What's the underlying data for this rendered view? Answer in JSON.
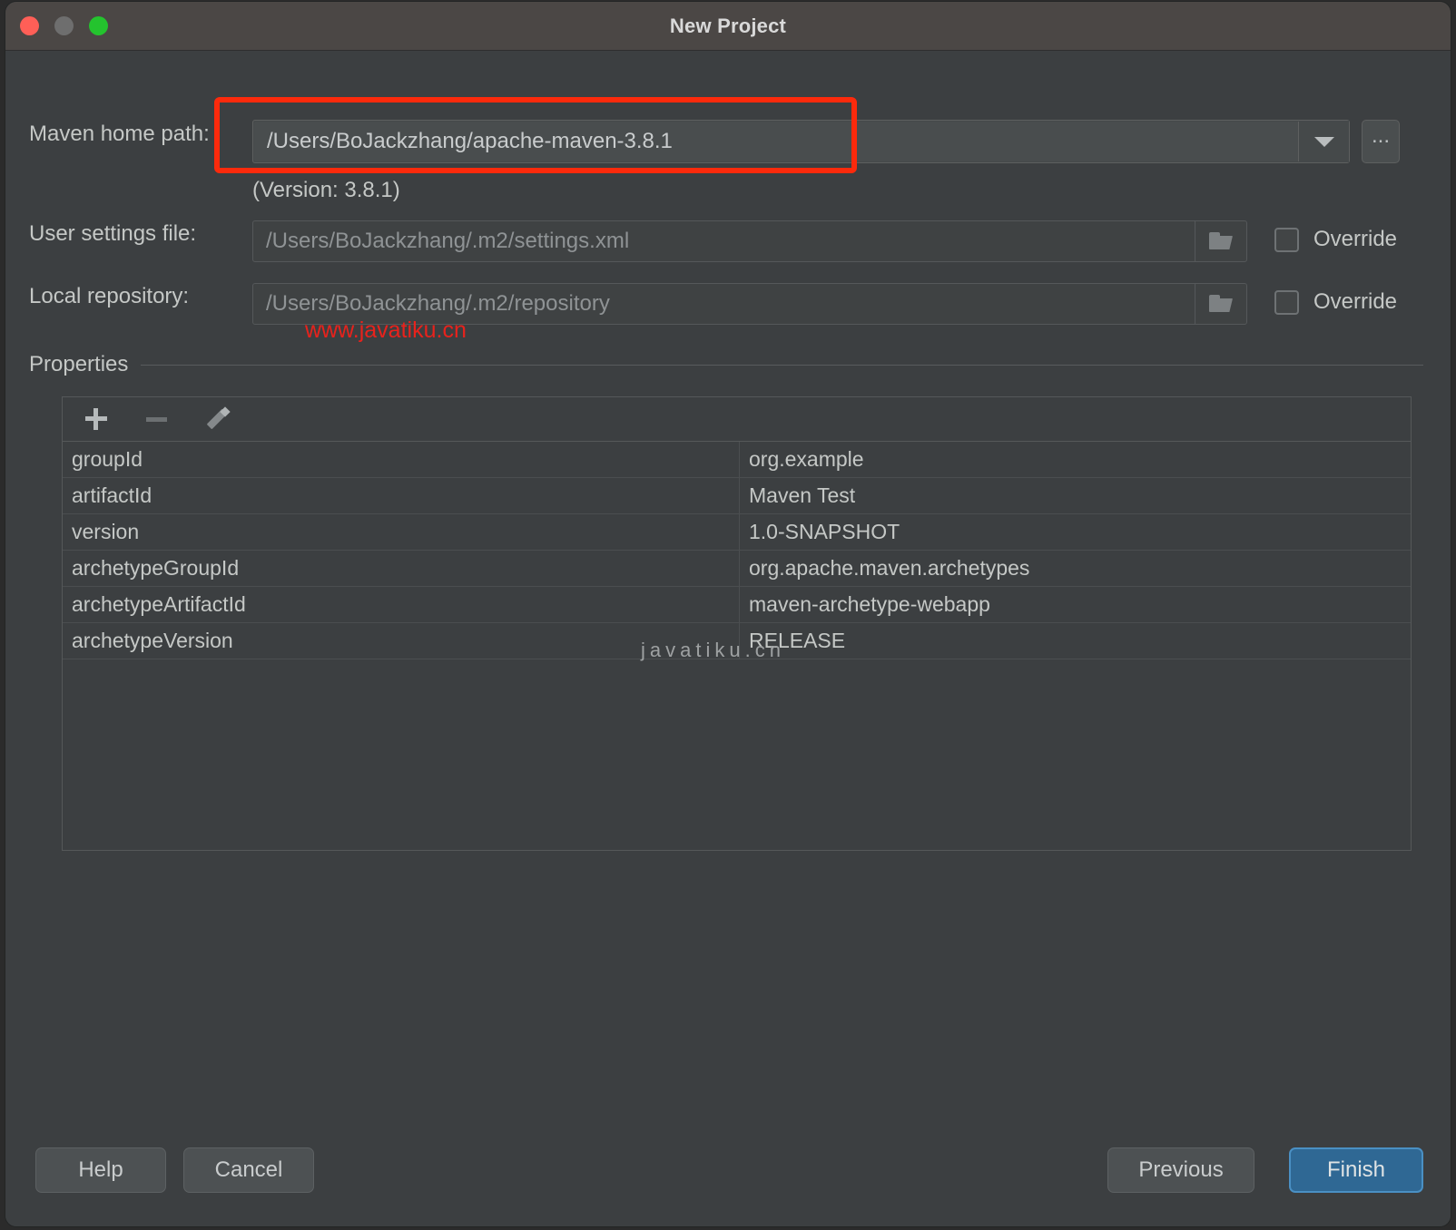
{
  "window": {
    "title": "New Project",
    "traffic_lights": [
      "close-button",
      "minimize-button",
      "zoom-button"
    ]
  },
  "form": {
    "maven_home_label": "Maven home path:",
    "maven_home_value": "/Users/BoJackzhang/apache-maven-3.8.1",
    "version_note": "(Version: 3.8.1)",
    "ellipsis_label": "...",
    "user_settings_label": "User settings file:",
    "user_settings_value": "/Users/BoJackzhang/.m2/settings.xml",
    "user_settings_override_label": "Override",
    "local_repo_label": "Local repository:",
    "local_repo_value": "/Users/BoJackzhang/.m2/repository",
    "local_repo_override_label": "Override"
  },
  "properties": {
    "section_title": "Properties",
    "toolbar": {
      "add_label": "add-property",
      "remove_label": "remove-property",
      "edit_label": "edit-property"
    },
    "rows": [
      {
        "key": "groupId",
        "value": "org.example"
      },
      {
        "key": "artifactId",
        "value": "Maven Test"
      },
      {
        "key": "version",
        "value": "1.0-SNAPSHOT"
      },
      {
        "key": "archetypeGroupId",
        "value": "org.apache.maven.archetypes"
      },
      {
        "key": "archetypeArtifactId",
        "value": "maven-archetype-webapp"
      },
      {
        "key": "archetypeVersion",
        "value": "RELEASE"
      }
    ]
  },
  "watermarks": {
    "red": "www.javatiku.cn",
    "gray": "javatiku.cn"
  },
  "footer": {
    "help": "Help",
    "cancel": "Cancel",
    "previous": "Previous",
    "finish": "Finish"
  },
  "colors": {
    "dialog_bg": "#3c3f41",
    "titlebar_bg": "#4b4745",
    "accent_primary": "#2f6894",
    "annotation_red": "#fc2a0c",
    "watermark_red": "#e8221c",
    "traffic_close": "#ff5f57",
    "traffic_min": "#6e6e6e",
    "traffic_zoom": "#24c32e"
  }
}
